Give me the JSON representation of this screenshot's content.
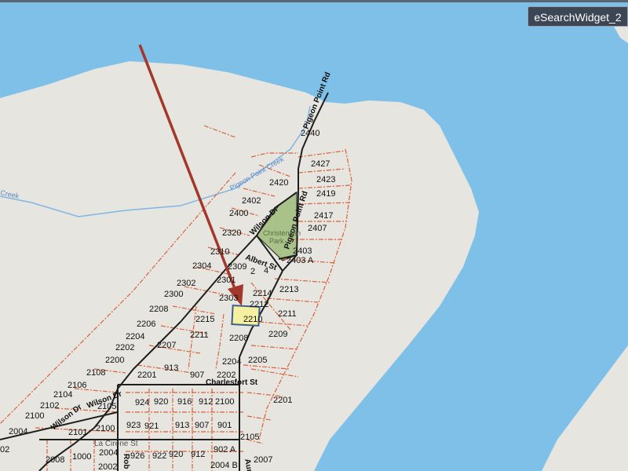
{
  "widget": {
    "label": "eSearchWidget_2"
  },
  "colors": {
    "water": "#7fc0e8",
    "land": "#e7e5e0",
    "parcel": "#d9623a",
    "road": "#1e1e1e",
    "park": "#a9c28a",
    "selected": "#f5f0a0",
    "arrow": "#a3382a"
  },
  "roads": {
    "pigeon_point_rd_north": "Pigeon Point Rd",
    "pigeon_point_rd_south": "Pigeon Point Rd",
    "wilson_dr_north": "Wilson Dr",
    "wilson_dr_south": "Wilson Dr",
    "wilson_dr_west": "Wilson Dr",
    "albert_st": "Albert St",
    "charlesfort_st": "Charlesfort St",
    "la_cirene_st": "La Cirene St",
    "robin": "Rob",
    "aur": "Aur"
  },
  "water_labels": {
    "creek": "Pigeon Point Creek",
    "creek_west": "Creek"
  },
  "park": {
    "line1": "Christensen",
    "line2": "Park"
  },
  "parcels": [
    {
      "n": "2440"
    },
    {
      "n": "2427"
    },
    {
      "n": "2423"
    },
    {
      "n": "2420"
    },
    {
      "n": "2419"
    },
    {
      "n": "2402"
    },
    {
      "n": "2400"
    },
    {
      "n": "2417"
    },
    {
      "n": "2407"
    },
    {
      "n": "2320"
    },
    {
      "n": "2403"
    },
    {
      "n": "2403 A"
    },
    {
      "n": "2310"
    },
    {
      "n": "2309"
    },
    {
      "n": "2304"
    },
    {
      "n": "2"
    },
    {
      "n": "4"
    },
    {
      "n": "2302"
    },
    {
      "n": "2301"
    },
    {
      "n": "2213"
    },
    {
      "n": "2300"
    },
    {
      "n": "2214"
    },
    {
      "n": "2303"
    },
    {
      "n": "2212"
    },
    {
      "n": "2208"
    },
    {
      "n": "2211"
    },
    {
      "n": "2215"
    },
    {
      "n": "2210"
    },
    {
      "n": "2206"
    },
    {
      "n": "2209"
    },
    {
      "n": "2204"
    },
    {
      "n": "2211"
    },
    {
      "n": "2208"
    },
    {
      "n": "2202"
    },
    {
      "n": "2207"
    },
    {
      "n": "2200"
    },
    {
      "n": "2205"
    },
    {
      "n": "2204"
    },
    {
      "n": "913"
    },
    {
      "n": "2108"
    },
    {
      "n": "2201"
    },
    {
      "n": "907"
    },
    {
      "n": "2202"
    },
    {
      "n": "2106"
    },
    {
      "n": "2104"
    },
    {
      "n": "2102"
    },
    {
      "n": "2105"
    },
    {
      "n": "924"
    },
    {
      "n": "920"
    },
    {
      "n": "916"
    },
    {
      "n": "912"
    },
    {
      "n": "2100"
    },
    {
      "n": "2201"
    },
    {
      "n": "2100"
    },
    {
      "n": "2004"
    },
    {
      "n": "2101"
    },
    {
      "n": "2100"
    },
    {
      "n": "923"
    },
    {
      "n": "921"
    },
    {
      "n": "913"
    },
    {
      "n": "907"
    },
    {
      "n": "901"
    },
    {
      "n": "2105"
    },
    {
      "n": "2004"
    },
    {
      "n": "902 A"
    },
    {
      "n": "02"
    },
    {
      "n": "2008"
    },
    {
      "n": "1000"
    },
    {
      "n": "926"
    },
    {
      "n": "922"
    },
    {
      "n": "920"
    },
    {
      "n": "912"
    },
    {
      "n": "2007"
    },
    {
      "n": "2002"
    },
    {
      "n": "2004 B"
    }
  ]
}
